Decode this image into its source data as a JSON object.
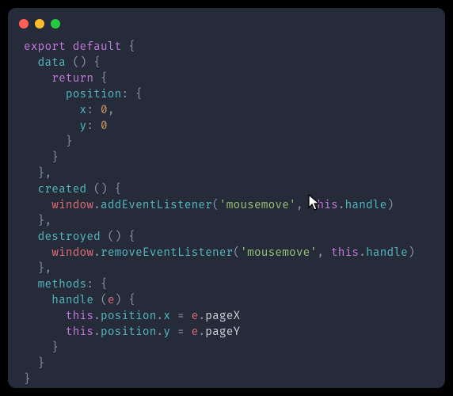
{
  "window": {
    "traffic_lights": {
      "close": "close",
      "minimize": "minimize",
      "maximize": "maximize"
    }
  },
  "code": {
    "kw_export": "export",
    "kw_default": "default",
    "kw_return": "return",
    "kw_this": "this",
    "fn_data": "data",
    "fn_created": "created",
    "fn_destroyed": "destroyed",
    "fn_methods": "methods",
    "fn_handle": "handle",
    "fn_addEventListener": "addEventListener",
    "fn_removeEventListener": "removeEventListener",
    "attr_position": "position",
    "attr_x": "x",
    "attr_y": "y",
    "prop_pageX": "pageX",
    "prop_pageY": "pageY",
    "ident_window": "window",
    "ident_e": "e",
    "num_zero": "0",
    "str_mousemove": "'mousemove'",
    "sp1": " ",
    "sp2": "  ",
    "sp4": "    ",
    "sp6": "      ",
    "sp8": "        ",
    "p_obrace": "{",
    "p_cbrace": "}",
    "p_oparen": "(",
    "p_cparen": ")",
    "p_colon": ":",
    "p_colon_sp": ": ",
    "p_comma": ",",
    "p_dot": ".",
    "p_eq": " = "
  },
  "cursor": {
    "name": "mouse-cursor"
  }
}
